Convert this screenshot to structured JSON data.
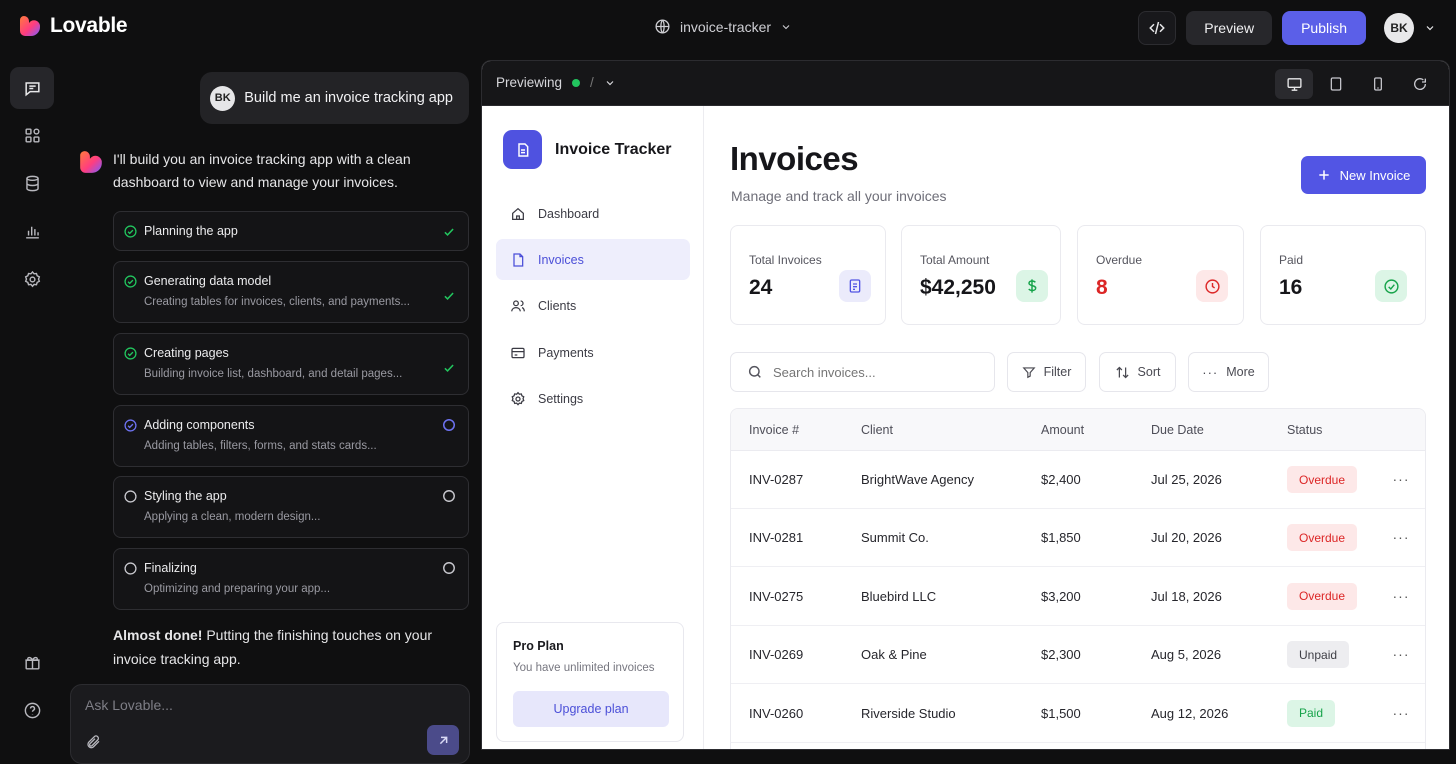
{
  "topbar": {
    "brand": "Lovable",
    "project": "invoice-tracker",
    "preview_label": "Preview",
    "publish_label": "Publish",
    "avatar": "BK",
    "accent": "#5b5fe8"
  },
  "chat": {
    "user_initials": "BK",
    "user_message": "Build me an invoice tracking app",
    "ai_intro": "I'll build you an invoice tracking app with a clean dashboard to view and manage your invoices.",
    "steps": [
      {
        "title": "Planning the app",
        "subtitle": "",
        "state": "done"
      },
      {
        "title": "Generating data model",
        "subtitle": "Creating tables for invoices, clients, and payments...",
        "state": "done"
      },
      {
        "title": "Creating pages",
        "subtitle": "Building invoice list, dashboard, and detail pages...",
        "state": "done"
      },
      {
        "title": "Adding components",
        "subtitle": "Adding tables, filters, forms, and stats cards...",
        "state": "in-progress"
      },
      {
        "title": "Styling the app",
        "subtitle": "Applying a clean, modern design...",
        "state": "pending"
      },
      {
        "title": "Finalizing",
        "subtitle": "Optimizing and preparing your app...",
        "state": "pending"
      }
    ],
    "almost_bold": "Almost done!",
    "almost_rest": " Putting the finishing touches on your invoice tracking app.",
    "composer_placeholder": "Ask Lovable..."
  },
  "preview": {
    "status_label": "Previewing",
    "path": "/"
  },
  "app": {
    "name": "Invoice Tracker",
    "nav": [
      {
        "label": "Dashboard",
        "icon": "home-icon",
        "active": false
      },
      {
        "label": "Invoices",
        "icon": "file-icon",
        "active": true
      },
      {
        "label": "Clients",
        "icon": "users-icon",
        "active": false
      },
      {
        "label": "Payments",
        "icon": "credit-card-icon",
        "active": false
      },
      {
        "label": "Settings",
        "icon": "gear-icon",
        "active": false
      }
    ],
    "plan": {
      "title": "Pro Plan",
      "subtitle": "You have unlimited invoices",
      "button": "Upgrade plan"
    },
    "page_title": "Invoices",
    "page_subtitle": "Manage and track all your invoices",
    "new_invoice_label": "New Invoice",
    "stats": [
      {
        "label": "Total Invoices",
        "value": "24",
        "icon": "document-icon",
        "color": "#16161a"
      },
      {
        "label": "Total Amount",
        "value": "$42,250",
        "icon": "dollar-icon",
        "color": "#16161a"
      },
      {
        "label": "Overdue",
        "value": "8",
        "icon": "clock-icon",
        "color": "#dc2626"
      },
      {
        "label": "Paid",
        "value": "16",
        "icon": "check-circle-icon",
        "color": "#16161a"
      }
    ],
    "search_placeholder": "Search invoices...",
    "filter_label": "Filter",
    "sort_label": "Sort",
    "more_label": "More",
    "columns": [
      "Invoice #",
      "Client",
      "Amount",
      "Due Date",
      "Status"
    ],
    "rows": [
      {
        "id": "INV-0287",
        "client": "BrightWave Agency",
        "amount": "$2,400",
        "due": "Jul 25, 2026",
        "status": "Overdue"
      },
      {
        "id": "INV-0281",
        "client": "Summit Co.",
        "amount": "$1,850",
        "due": "Jul 20, 2026",
        "status": "Overdue"
      },
      {
        "id": "INV-0275",
        "client": "Bluebird LLC",
        "amount": "$3,200",
        "due": "Jul 18, 2026",
        "status": "Overdue"
      },
      {
        "id": "INV-0269",
        "client": "Oak & Pine",
        "amount": "$2,300",
        "due": "Aug 5, 2026",
        "status": "Unpaid"
      },
      {
        "id": "INV-0260",
        "client": "Riverside Studio",
        "amount": "$1,500",
        "due": "Aug 12, 2026",
        "status": "Paid"
      }
    ],
    "status_colors": {
      "Overdue": {
        "bg": "#fde8e8",
        "fg": "#dc2626"
      },
      "Unpaid": {
        "bg": "#ededf0",
        "fg": "#3f3f46"
      },
      "Paid": {
        "bg": "#dcf5e6",
        "fg": "#16a34a"
      }
    }
  }
}
